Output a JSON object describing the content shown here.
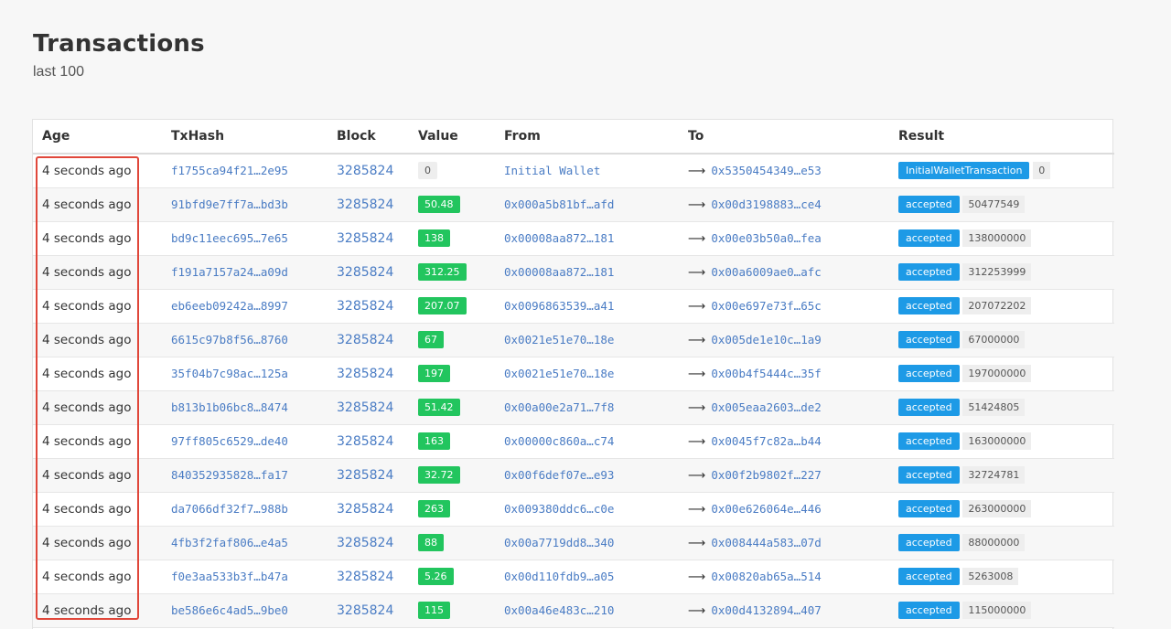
{
  "header": {
    "title": "Transactions",
    "subtitle": "last 100"
  },
  "columns": [
    "Age",
    "TxHash",
    "Block",
    "Value",
    "From",
    "To",
    "Result"
  ],
  "rows": [
    {
      "age": "4 seconds ago",
      "hash": "f1755ca94f21…2e95",
      "block": "3285824",
      "value": "0",
      "from": "Initial Wallet",
      "arrow": "⟶",
      "to": "0x5350454349…e53",
      "result": "InitialWalletTransaction",
      "result_val": "0"
    },
    {
      "age": "4 seconds ago",
      "hash": "91bfd9e7ff7a…bd3b",
      "block": "3285824",
      "value": "50.48",
      "from": "0x000a5b81bf…afd",
      "arrow": "⟶",
      "to": "0x00d3198883…ce4",
      "result": "accepted",
      "result_val": "50477549"
    },
    {
      "age": "4 seconds ago",
      "hash": "bd9c11eec695…7e65",
      "block": "3285824",
      "value": "138",
      "from": "0x00008aa872…181",
      "arrow": "⟶",
      "to": "0x00e03b50a0…fea",
      "result": "accepted",
      "result_val": "138000000"
    },
    {
      "age": "4 seconds ago",
      "hash": "f191a7157a24…a09d",
      "block": "3285824",
      "value": "312.25",
      "from": "0x00008aa872…181",
      "arrow": "⟶",
      "to": "0x00a6009ae0…afc",
      "result": "accepted",
      "result_val": "312253999"
    },
    {
      "age": "4 seconds ago",
      "hash": "eb6eeb09242a…8997",
      "block": "3285824",
      "value": "207.07",
      "from": "0x0096863539…a41",
      "arrow": "⟶",
      "to": "0x00e697e73f…65c",
      "result": "accepted",
      "result_val": "207072202"
    },
    {
      "age": "4 seconds ago",
      "hash": "6615c97b8f56…8760",
      "block": "3285824",
      "value": "67",
      "from": "0x0021e51e70…18e",
      "arrow": "⟶",
      "to": "0x005de1e10c…1a9",
      "result": "accepted",
      "result_val": "67000000"
    },
    {
      "age": "4 seconds ago",
      "hash": "35f04b7c98ac…125a",
      "block": "3285824",
      "value": "197",
      "from": "0x0021e51e70…18e",
      "arrow": "⟶",
      "to": "0x00b4f5444c…35f",
      "result": "accepted",
      "result_val": "197000000"
    },
    {
      "age": "4 seconds ago",
      "hash": "b813b1b06bc8…8474",
      "block": "3285824",
      "value": "51.42",
      "from": "0x00a00e2a71…7f8",
      "arrow": "⟶",
      "to": "0x005eaa2603…de2",
      "result": "accepted",
      "result_val": "51424805"
    },
    {
      "age": "4 seconds ago",
      "hash": "97ff805c6529…de40",
      "block": "3285824",
      "value": "163",
      "from": "0x00000c860a…c74",
      "arrow": "⟶",
      "to": "0x0045f7c82a…b44",
      "result": "accepted",
      "result_val": "163000000"
    },
    {
      "age": "4 seconds ago",
      "hash": "840352935828…fa17",
      "block": "3285824",
      "value": "32.72",
      "from": "0x00f6def07e…e93",
      "arrow": "⟶",
      "to": "0x00f2b9802f…227",
      "result": "accepted",
      "result_val": "32724781"
    },
    {
      "age": "4 seconds ago",
      "hash": "da7066df32f7…988b",
      "block": "3285824",
      "value": "263",
      "from": "0x009380ddc6…c0e",
      "arrow": "⟶",
      "to": "0x00e626064e…446",
      "result": "accepted",
      "result_val": "263000000"
    },
    {
      "age": "4 seconds ago",
      "hash": "4fb3f2faf806…e4a5",
      "block": "3285824",
      "value": "88",
      "from": "0x00a7719dd8…340",
      "arrow": "⟶",
      "to": "0x008444a583…07d",
      "result": "accepted",
      "result_val": "88000000"
    },
    {
      "age": "4 seconds ago",
      "hash": "f0e3aa533b3f…b47a",
      "block": "3285824",
      "value": "5.26",
      "from": "0x00d110fdb9…a05",
      "arrow": "⟶",
      "to": "0x00820ab65a…514",
      "result": "accepted",
      "result_val": "5263008"
    },
    {
      "age": "4 seconds ago",
      "hash": "be586e6c4ad5…9be0",
      "block": "3285824",
      "value": "115",
      "from": "0x00a46e483c…210",
      "arrow": "⟶",
      "to": "0x00d4132894…407",
      "result": "accepted",
      "result_val": "115000000"
    }
  ],
  "colors": {
    "value_badge": "#22c55e",
    "result_badge": "#1d9ae6",
    "highlight": "#e0473a",
    "link": "#4a7cc4"
  }
}
